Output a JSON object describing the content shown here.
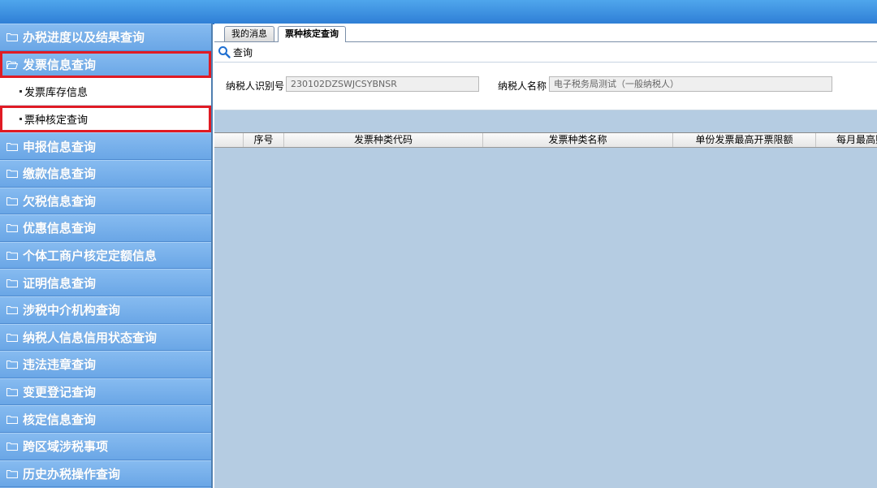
{
  "sidebar": {
    "items": [
      {
        "label": "办税进度以及结果查询"
      },
      {
        "label": "发票信息查询",
        "expanded": true,
        "highlighted": true,
        "children": [
          {
            "label": "发票库存信息"
          },
          {
            "label": "票种核定查询",
            "highlighted": true
          }
        ]
      },
      {
        "label": "申报信息查询"
      },
      {
        "label": "缴款信息查询"
      },
      {
        "label": "欠税信息查询"
      },
      {
        "label": "优惠信息查询"
      },
      {
        "label": "个体工商户核定定额信息"
      },
      {
        "label": "证明信息查询"
      },
      {
        "label": "涉税中介机构查询"
      },
      {
        "label": "纳税人信息信用状态查询"
      },
      {
        "label": "违法违章查询"
      },
      {
        "label": "变更登记查询"
      },
      {
        "label": "核定信息查询"
      },
      {
        "label": "跨区域涉税事项"
      },
      {
        "label": "历史办税操作查询"
      }
    ]
  },
  "tabs": [
    {
      "label": "我的消息",
      "active": false
    },
    {
      "label": "票种核定查询",
      "active": true
    }
  ],
  "toolbar": {
    "query_label": "查询",
    "icon": "search-icon"
  },
  "form": {
    "taxpayer_id_label": "纳税人识别号",
    "taxpayer_id_value": "230102DZSWJCSYBNSR",
    "taxpayer_name_label": "纳税人名称",
    "taxpayer_name_value": "电子税务局测试（一般纳税人）"
  },
  "grid": {
    "columns": [
      "序号",
      "发票种类代码",
      "发票种类名称",
      "单份发票最高开票限额",
      "每月最高购"
    ],
    "rows": []
  },
  "colors": {
    "topbar": "#2f7fd6",
    "sidebar_item": "#7fb3ea",
    "highlight": "#e01b24",
    "main_bg": "#b5cce2"
  }
}
